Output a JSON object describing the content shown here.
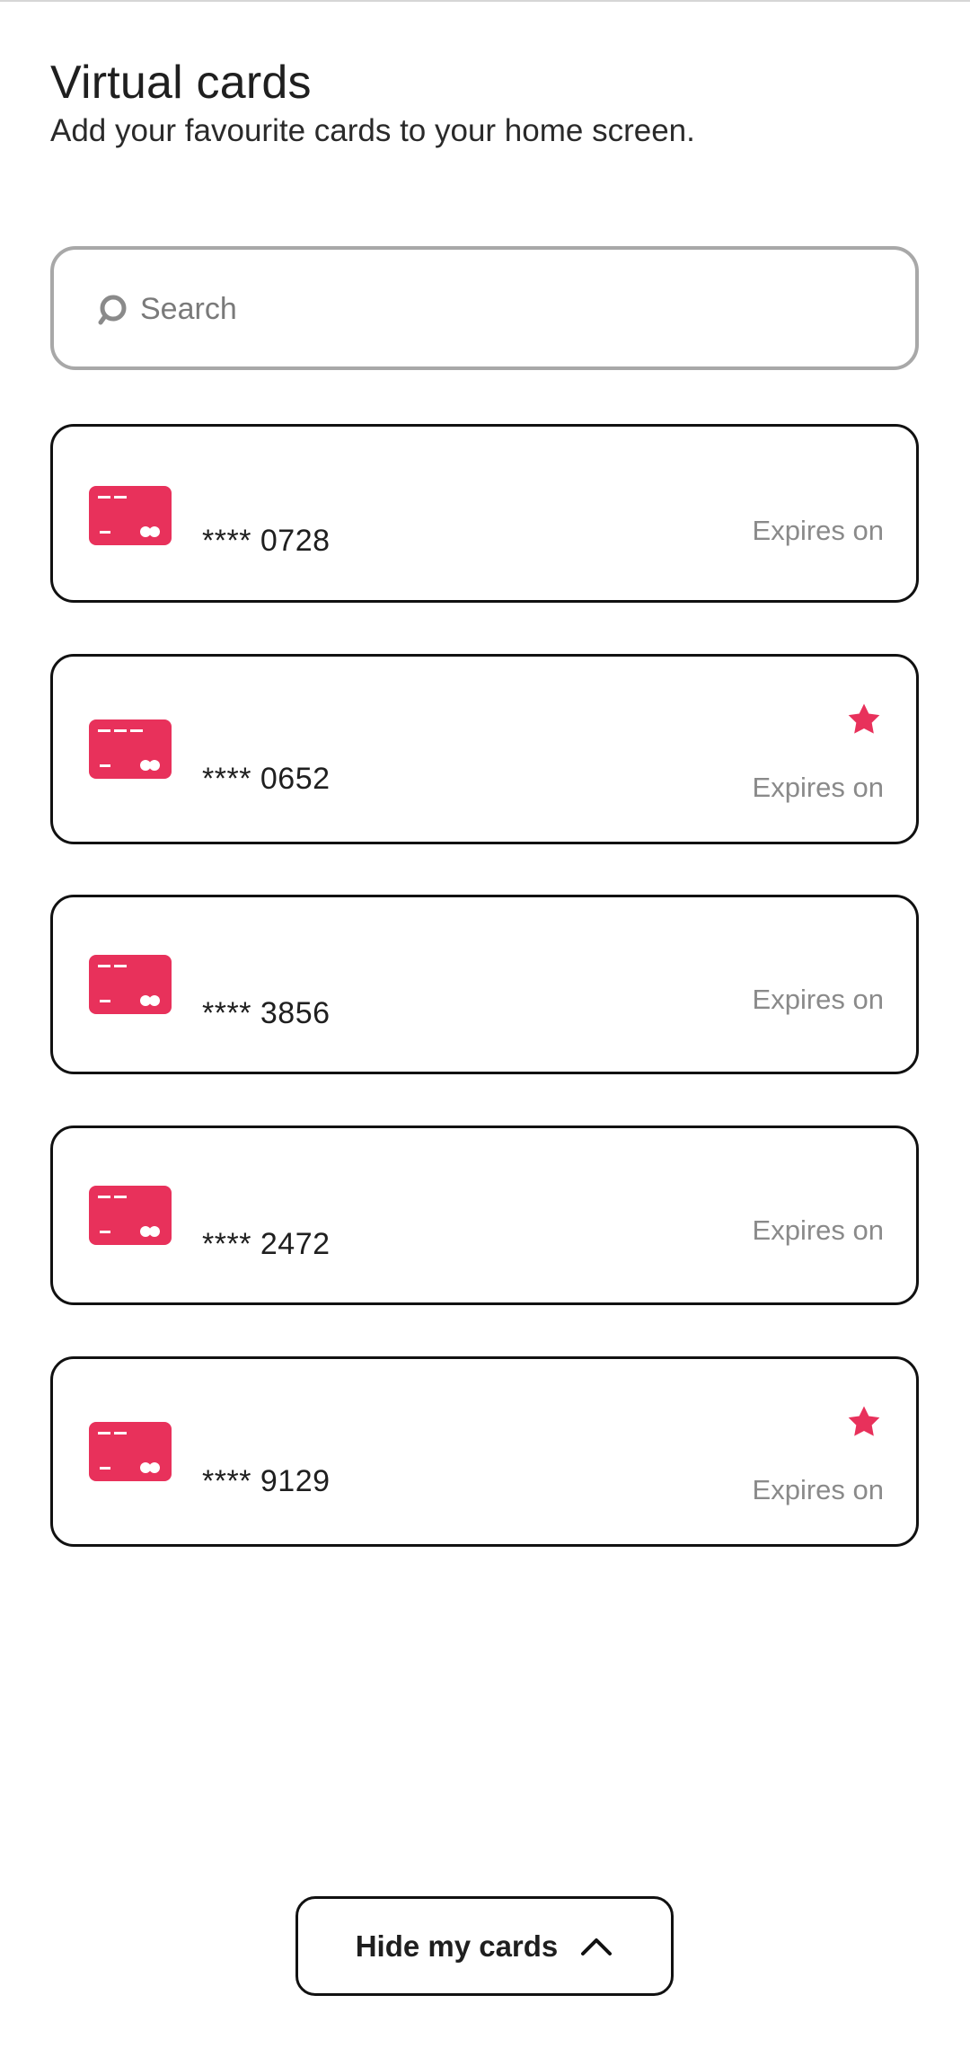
{
  "header": {
    "title": "Virtual cards",
    "subtitle": "Add your favourite cards to your home screen."
  },
  "search": {
    "placeholder": "Search",
    "value": "",
    "icon": "search-icon"
  },
  "cards": [
    {
      "masked_number": "**** 0728",
      "expiry": "Expires on",
      "favourite": false
    },
    {
      "masked_number": "**** 0652",
      "expiry": "Expires on",
      "favourite": true
    },
    {
      "masked_number": "**** 3856",
      "expiry": "Expires on",
      "favourite": false
    },
    {
      "masked_number": "**** 2472",
      "expiry": "Expires on",
      "favourite": false
    },
    {
      "masked_number": "**** 9129",
      "expiry": "Expires on",
      "favourite": true
    }
  ],
  "footer": {
    "hide_button_label": "Hide my cards",
    "hide_button_icon": "chevron-up-icon"
  },
  "colors": {
    "accent": "#e8315b",
    "border": "#111111",
    "muted_text": "#8a8a8a"
  }
}
